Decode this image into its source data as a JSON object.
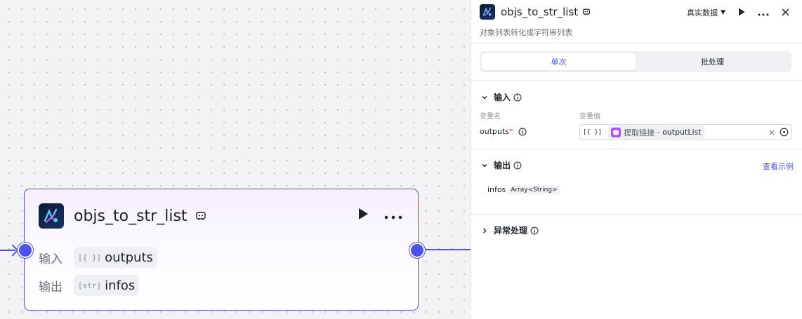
{
  "node": {
    "title": "objs_to_str_list",
    "inputs_label": "输入",
    "outputs_label": "输出",
    "input_type": "[{ }]",
    "input_name": "outputs",
    "output_type": "[str]",
    "output_name": "infos"
  },
  "panel": {
    "title": "objs_to_str_list",
    "description": "对象列表转化成字符串列表",
    "data_source": "真实数据",
    "tabs": [
      "单次",
      "批处理"
    ],
    "input_section": "输入",
    "col_var_name": "变量名",
    "col_var_value": "变量值",
    "param_name": "outputs",
    "param_required_mark": "*",
    "param_type": "[{ }]",
    "ref_node": "提取链接",
    "ref_sep": " - ",
    "ref_field": "outputList",
    "clear_symbol": "×",
    "output_section": "输出",
    "view_example": "查看示例",
    "output_name": "infos",
    "output_type": "Array<String>",
    "error_section": "异常处理"
  },
  "colors": {
    "accent": "#4d53e8",
    "ref_icon": "#b455e8",
    "required": "#f53f3f"
  }
}
